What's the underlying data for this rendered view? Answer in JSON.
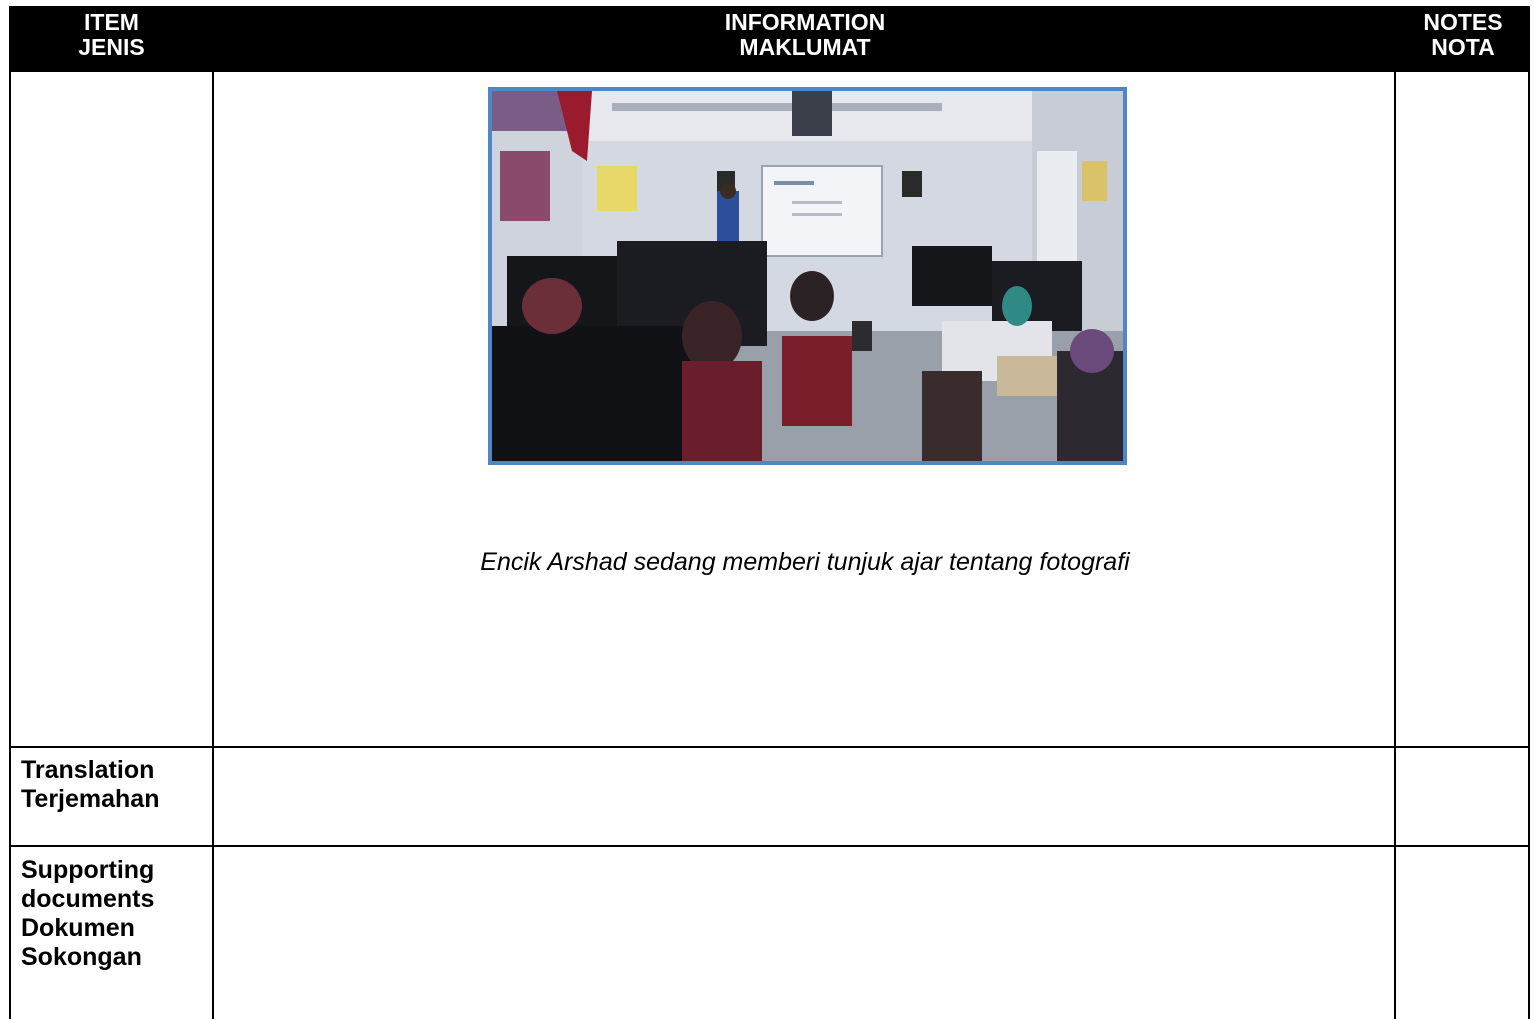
{
  "header": {
    "item_en": "ITEM",
    "item_ms": "JENIS",
    "info_en": "INFORMATION",
    "info_ms": "MAKLUMAT",
    "notes_en": "NOTES",
    "notes_ms": "NOTA"
  },
  "photo": {
    "caption": "Encik Arshad sedang memberi tunjuk ajar tentang fotografi",
    "frame_color": "#4f86c6"
  },
  "rows": {
    "translation": [
      "Translation",
      "Terjemahan"
    ],
    "supporting": [
      "Supporting",
      "documents",
      "Dokumen",
      "Sokongan"
    ]
  }
}
